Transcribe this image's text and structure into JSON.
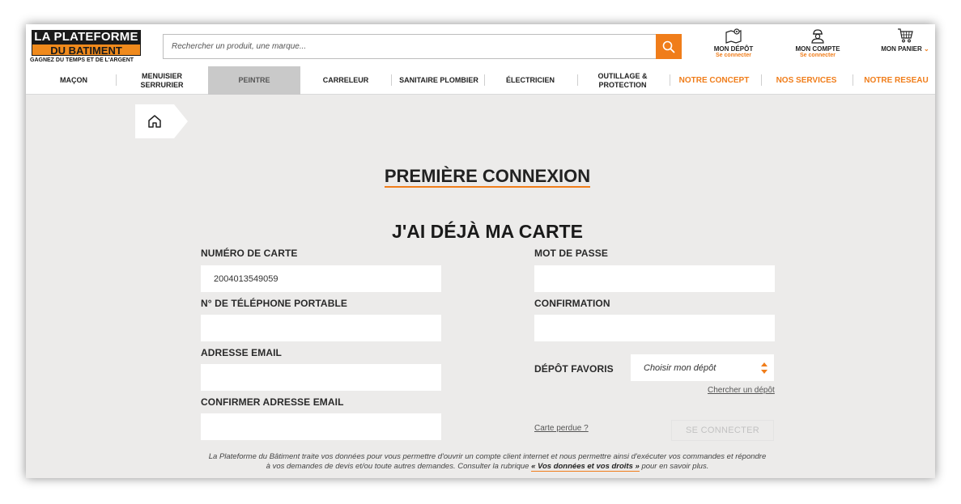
{
  "brand": {
    "line1": "LA PLATEFORME",
    "line2": "DU BATIMENT",
    "tagline": "GAGNEZ DU TEMPS ET DE L'ARGENT"
  },
  "search": {
    "placeholder": "Rechercher un produit, une marque..."
  },
  "header": {
    "depot": {
      "label": "MON DÉPÔT",
      "sub": "Se connecter"
    },
    "compte": {
      "label": "MON COMPTE",
      "sub": "Se connecter"
    },
    "panier": {
      "label": "MON PANIER"
    }
  },
  "nav": {
    "items": [
      {
        "label": "MAÇON"
      },
      {
        "label": "MENUISIER SERRURIER"
      },
      {
        "label": "PEINTRE"
      },
      {
        "label": "CARRELEUR"
      },
      {
        "label": "SANITAIRE PLOMBIER"
      },
      {
        "label": "ÉLECTRICIEN"
      },
      {
        "label": "OUTILLAGE & PROTECTION"
      },
      {
        "label": "NOTRE CONCEPT"
      },
      {
        "label": "NOS SERVICES"
      },
      {
        "label": "NOTRE RESEAU"
      }
    ]
  },
  "page": {
    "title": "PREMIÈRE CONNEXION",
    "subtitle": "J'AI DÉJÀ MA CARTE"
  },
  "form": {
    "card_number_label": "NUMÉRO DE CARTE",
    "card_number_value": "2004013549059",
    "phone_label": "N° DE TÉLÉPHONE PORTABLE",
    "email_label": "ADRESSE EMAIL",
    "email_confirm_label": "CONFIRMER ADRESSE EMAIL",
    "password_label": "MOT DE PASSE",
    "confirmation_label": "CONFIRMATION",
    "depot_label": "DÉPÔT FAVORIS",
    "depot_select": "Choisir mon dépôt",
    "search_depot_link": "Chercher un dépôt",
    "lost_card_link": "Carte perdue ?",
    "submit_label": "SE CONNECTER"
  },
  "legal": {
    "text_a": "La Plateforme du Bâtiment traite vos données pour vous permettre d'ouvrir un compte client internet et nous permettre ainsi d'exécuter vos commandes et répondre à vos demandes de devis et/ou toute autres demandes. Consulter la rubrique ",
    "link": "« Vos données et vos droits »",
    "text_b": " pour en savoir plus."
  },
  "colors": {
    "accent": "#f07d1a",
    "background": "#ecebea",
    "active_tab": "#c9c9c9"
  }
}
